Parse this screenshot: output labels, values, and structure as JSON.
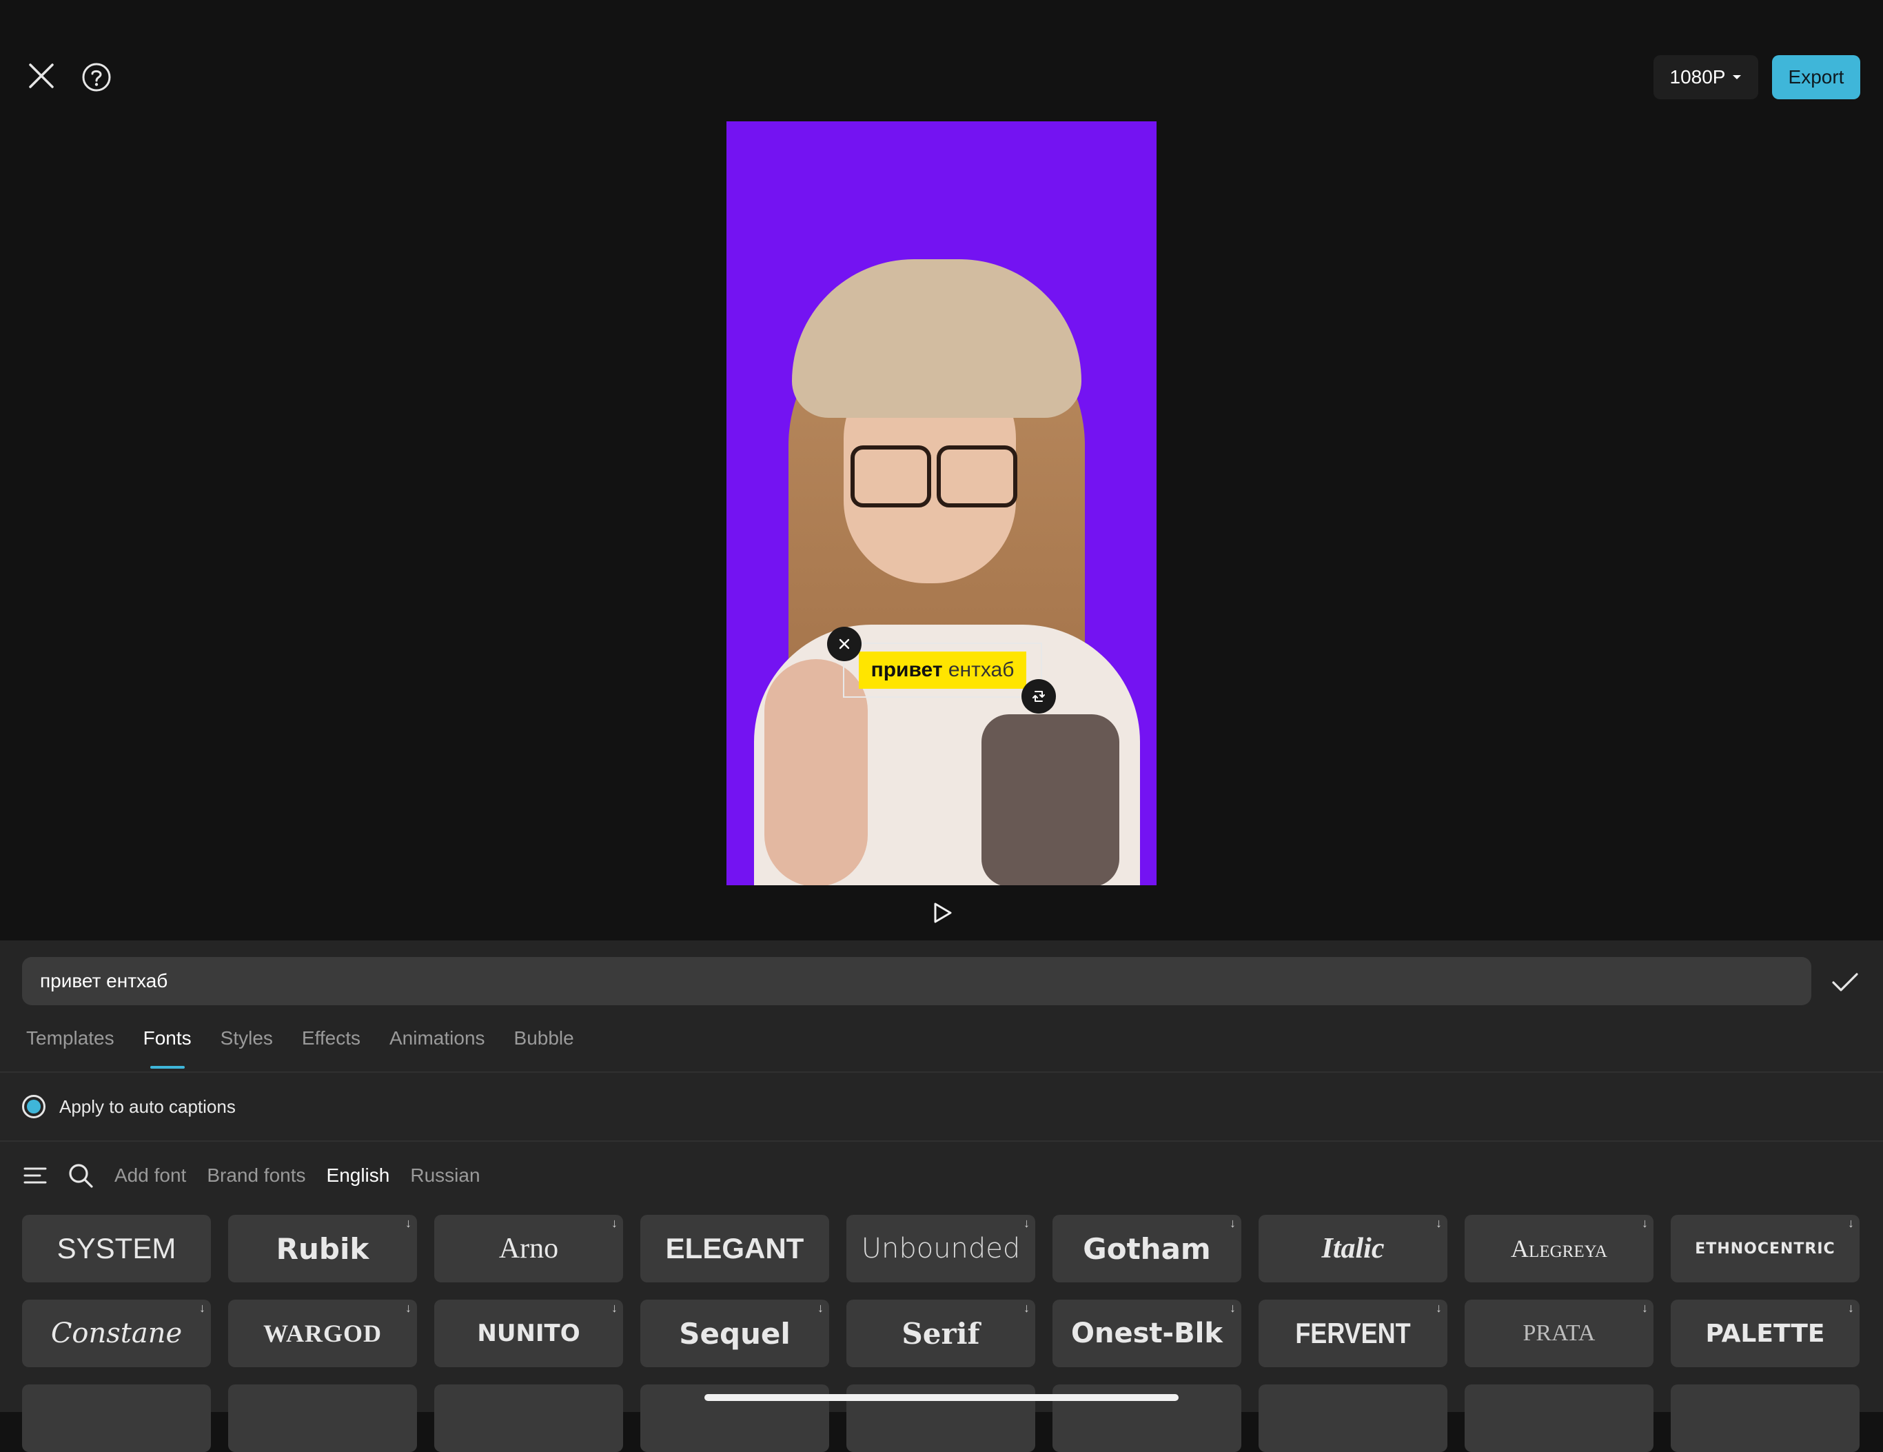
{
  "toolbar": {
    "resolution_label": "1080P",
    "export_label": "Export"
  },
  "preview": {
    "caption_primary": "привет",
    "caption_secondary": "ентхаб"
  },
  "editor": {
    "text_value": "привет ентхаб"
  },
  "tabs": [
    {
      "label": "Templates"
    },
    {
      "label": "Fonts"
    },
    {
      "label": "Styles"
    },
    {
      "label": "Effects"
    },
    {
      "label": "Animations"
    },
    {
      "label": "Bubble"
    }
  ],
  "apply_captions_label": "Apply to auto captions",
  "font_filters": {
    "add_font": "Add font",
    "brand_fonts": "Brand fonts",
    "english": "English",
    "russian": "Russian"
  },
  "fonts": [
    "SYSTEM",
    "Rubik",
    "Arno",
    "ELEGANT",
    "Unbounded",
    "Gotham",
    "Italic",
    "Alegreya",
    "ETHNOCENTRIC",
    "Constane",
    "WARGOD",
    "NUNITO",
    "Sequel",
    "Serif",
    "Onest-Blk",
    "FERVENT",
    "PRATA",
    "PALETTE"
  ],
  "colors": {
    "accent": "#3fb6d9",
    "preview_background": "#7413f2",
    "caption_highlight": "#ffe500"
  }
}
